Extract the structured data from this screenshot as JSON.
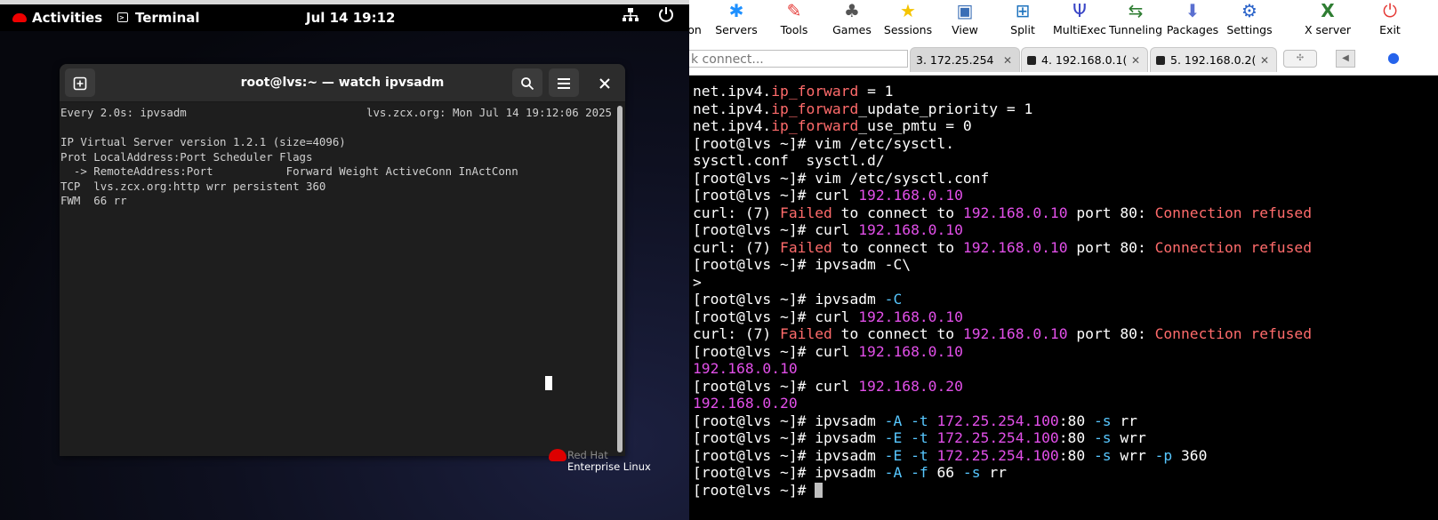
{
  "gnome": {
    "activities": "Activities",
    "app_name": "Terminal",
    "clock": "Jul 14  19:12",
    "watermark_line1": "Red Hat",
    "watermark_line2": "Enterprise Linux"
  },
  "terminal_window": {
    "title": "root@lvs:~ — watch ipvsadm",
    "watch_left": "Every 2.0s: ipvsadm",
    "watch_right": "lvs.zcx.org: Mon Jul 14 19:12:06 2025",
    "lines": [
      "IP Virtual Server version 1.2.1 (size=4096)",
      "Prot LocalAddress:Port Scheduler Flags",
      "  -> RemoteAddress:Port           Forward Weight ActiveConn InActConn",
      "TCP  lvs.zcx.org:http wrr persistent 360",
      "FWM  66 rr"
    ]
  },
  "moba": {
    "toolbar": [
      {
        "label": "on",
        "icon": "session-icon"
      },
      {
        "label": "Servers",
        "icon": "servers-icon"
      },
      {
        "label": "Tools",
        "icon": "tools-icon"
      },
      {
        "label": "Games",
        "icon": "games-icon"
      },
      {
        "label": "Sessions",
        "icon": "star-icon"
      },
      {
        "label": "View",
        "icon": "view-icon"
      },
      {
        "label": "Split",
        "icon": "split-icon"
      },
      {
        "label": "MultiExec",
        "icon": "multiexec-icon"
      },
      {
        "label": "Tunneling",
        "icon": "tunneling-icon"
      },
      {
        "label": "Packages",
        "icon": "packages-icon"
      },
      {
        "label": "Settings",
        "icon": "gear-icon"
      },
      {
        "label": "X server",
        "icon": "xserver-icon"
      },
      {
        "label": "Exit",
        "icon": "power-icon"
      }
    ],
    "quick_connect": "k connect...",
    "tabs": [
      {
        "label": "3. 172.25.254"
      },
      {
        "label": "4. 192.168.0.1("
      },
      {
        "label": "5. 192.168.0.2("
      }
    ],
    "terminal_lines": [
      [
        [
          "net.ipv4.",
          ""
        ],
        [
          "ip_forward",
          "red"
        ],
        [
          " = 1",
          ""
        ]
      ],
      [
        [
          "net.ipv4.",
          ""
        ],
        [
          "ip_forward",
          "red"
        ],
        [
          "_update_priority = 1",
          ""
        ]
      ],
      [
        [
          "net.ipv4.",
          ""
        ],
        [
          "ip_forward",
          "red"
        ],
        [
          "_use_pmtu = 0",
          ""
        ]
      ],
      [
        [
          "[root@lvs ~]# vim /etc/sysctl.",
          ""
        ]
      ],
      [
        [
          "sysctl.conf  sysctl.d/",
          ""
        ]
      ],
      [
        [
          "[root@lvs ~]# vim /etc/sysctl.conf",
          ""
        ]
      ],
      [
        [
          "[root@lvs ~]# curl ",
          ""
        ],
        [
          "192.168.0.10",
          "mag"
        ]
      ],
      [
        [
          "curl: (7) ",
          ""
        ],
        [
          "Failed",
          "red"
        ],
        [
          " to connect to ",
          ""
        ],
        [
          "192.168.0.10",
          "mag"
        ],
        [
          " port 80: ",
          ""
        ],
        [
          "Connection refused",
          "red"
        ]
      ],
      [
        [
          "[root@lvs ~]# curl ",
          ""
        ],
        [
          "192.168.0.10",
          "mag"
        ]
      ],
      [
        [
          "curl: (7) ",
          ""
        ],
        [
          "Failed",
          "red"
        ],
        [
          " to connect to ",
          ""
        ],
        [
          "192.168.0.10",
          "mag"
        ],
        [
          " port 80: ",
          ""
        ],
        [
          "Connection refused",
          "red"
        ]
      ],
      [
        [
          "[root@lvs ~]# ipvsadm -C\\",
          ""
        ]
      ],
      [
        [
          ">",
          ""
        ]
      ],
      [
        [
          "[root@lvs ~]# ipvsadm ",
          ""
        ],
        [
          "-C",
          "cyan"
        ]
      ],
      [
        [
          "[root@lvs ~]# curl ",
          ""
        ],
        [
          "192.168.0.10",
          "mag"
        ]
      ],
      [
        [
          "curl: (7) ",
          ""
        ],
        [
          "Failed",
          "red"
        ],
        [
          " to connect to ",
          ""
        ],
        [
          "192.168.0.10",
          "mag"
        ],
        [
          " port 80: ",
          ""
        ],
        [
          "Connection refused",
          "red"
        ]
      ],
      [
        [
          "[root@lvs ~]# curl ",
          ""
        ],
        [
          "192.168.0.10",
          "mag"
        ]
      ],
      [
        [
          "192.168.0.10",
          "mag"
        ]
      ],
      [
        [
          "[root@lvs ~]# curl ",
          ""
        ],
        [
          "192.168.0.20",
          "mag"
        ]
      ],
      [
        [
          "192.168.0.20",
          "mag"
        ]
      ],
      [
        [
          "[root@lvs ~]# ipvsadm ",
          ""
        ],
        [
          "-A",
          "cyan"
        ],
        [
          " ",
          ""
        ],
        [
          "-t",
          "cyan"
        ],
        [
          " ",
          ""
        ],
        [
          "172.25.254.100",
          "mag"
        ],
        [
          ":80 ",
          ""
        ],
        [
          "-s",
          "cyan"
        ],
        [
          " rr",
          ""
        ]
      ],
      [
        [
          "[root@lvs ~]# ipvsadm ",
          ""
        ],
        [
          "-E",
          "cyan"
        ],
        [
          " ",
          ""
        ],
        [
          "-t",
          "cyan"
        ],
        [
          " ",
          ""
        ],
        [
          "172.25.254.100",
          "mag"
        ],
        [
          ":80 ",
          ""
        ],
        [
          "-s",
          "cyan"
        ],
        [
          " wrr",
          ""
        ]
      ],
      [
        [
          "[root@lvs ~]# ipvsadm ",
          ""
        ],
        [
          "-E",
          "cyan"
        ],
        [
          " ",
          ""
        ],
        [
          "-t",
          "cyan"
        ],
        [
          " ",
          ""
        ],
        [
          "172.25.254.100",
          "mag"
        ],
        [
          ":80 ",
          ""
        ],
        [
          "-s",
          "cyan"
        ],
        [
          " wrr ",
          ""
        ],
        [
          "-p",
          "cyan"
        ],
        [
          " 360",
          ""
        ]
      ],
      [
        [
          "[root@lvs ~]# ipvsadm ",
          ""
        ],
        [
          "-A",
          "cyan"
        ],
        [
          " ",
          ""
        ],
        [
          "-f",
          "cyan"
        ],
        [
          " 66 ",
          ""
        ],
        [
          "-s",
          "cyan"
        ],
        [
          " rr",
          ""
        ]
      ],
      [
        [
          "[root@lvs ~]# ",
          ""
        ]
      ]
    ]
  },
  "colors": {
    "red": "#ff6b6b",
    "mag": "#e14fe8",
    "cyan": "#57c7ff",
    "terminal_bg": "#1e1e1e",
    "moba_bg": "#000000"
  }
}
